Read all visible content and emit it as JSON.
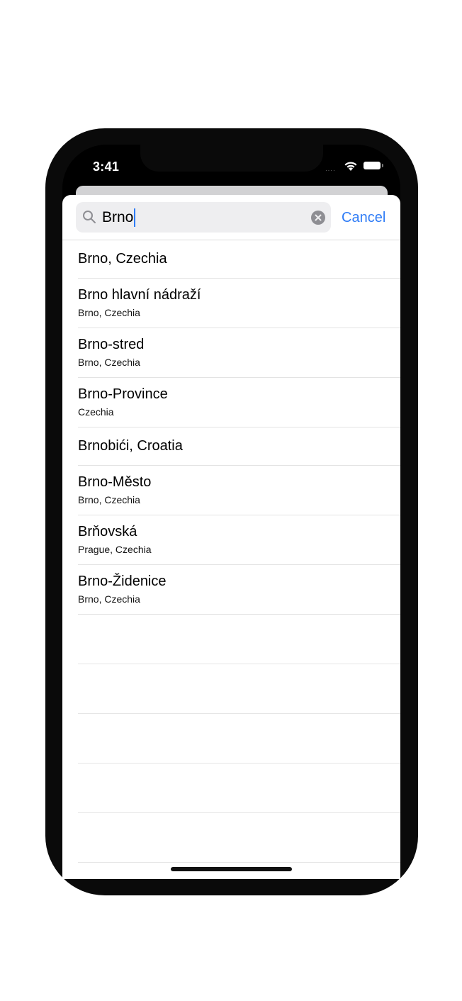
{
  "status_bar": {
    "time": "3:41"
  },
  "search": {
    "query": "Brno",
    "cancel_label": "Cancel"
  },
  "results": [
    {
      "title": "Brno, Czechia",
      "subtitle": ""
    },
    {
      "title": "Brno hlavní nádraží",
      "subtitle": "Brno, Czechia"
    },
    {
      "title": "Brno-stred",
      "subtitle": "Brno, Czechia"
    },
    {
      "title": "Brno-Province",
      "subtitle": "Czechia"
    },
    {
      "title": "Brnobići, Croatia",
      "subtitle": ""
    },
    {
      "title": "Brno-Město",
      "subtitle": "Brno, Czechia"
    },
    {
      "title": "Brňovská",
      "subtitle": "Prague, Czechia"
    },
    {
      "title": "Brno-Židenice",
      "subtitle": "Brno, Czechia"
    }
  ],
  "colors": {
    "accent": "#2f7cf6",
    "field_bg": "#eeeef0"
  }
}
